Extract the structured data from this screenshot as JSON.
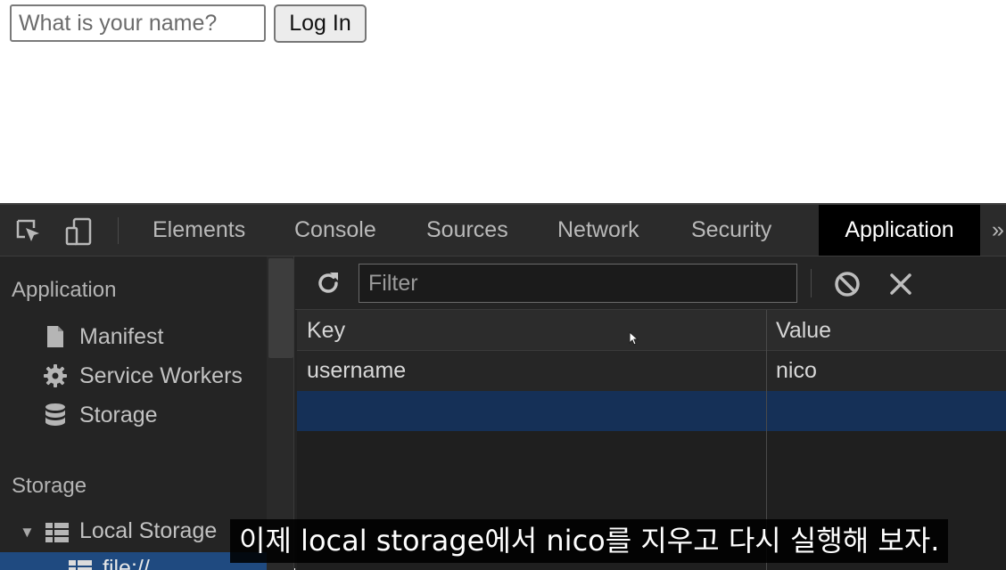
{
  "page": {
    "name_input": {
      "placeholder": "What is your name?",
      "value": ""
    },
    "login_button": {
      "label": "Log In"
    }
  },
  "devtools": {
    "tabs": [
      {
        "label": "Elements"
      },
      {
        "label": "Console"
      },
      {
        "label": "Sources"
      },
      {
        "label": "Network"
      },
      {
        "label": "Security"
      },
      {
        "label": "Application",
        "active": true
      }
    ],
    "more_tabs": "»",
    "icons": {
      "inspect": "inspect-cursor-icon",
      "device": "device-toggle-icon"
    },
    "sidebar": {
      "application_heading": "Application",
      "application_items": [
        {
          "label": "Manifest",
          "icon": "document-icon"
        },
        {
          "label": "Service Workers",
          "icon": "gear-icon"
        },
        {
          "label": "Storage",
          "icon": "database-icon"
        }
      ],
      "storage_heading": "Storage",
      "local_storage": {
        "label": "Local Storage",
        "icon": "grid-icon",
        "expanded": true
      },
      "file_entry": {
        "label": "file://",
        "icon": "grid-icon",
        "selected": true
      }
    },
    "toolbar": {
      "filter_placeholder": "Filter",
      "filter_value": ""
    },
    "table": {
      "columns": [
        "Key",
        "Value"
      ],
      "rows": [
        {
          "key": "username",
          "value": "nico"
        }
      ]
    }
  },
  "subtitle": "이제 local storage에서 nico를 지우고 다시 실행해 보자."
}
